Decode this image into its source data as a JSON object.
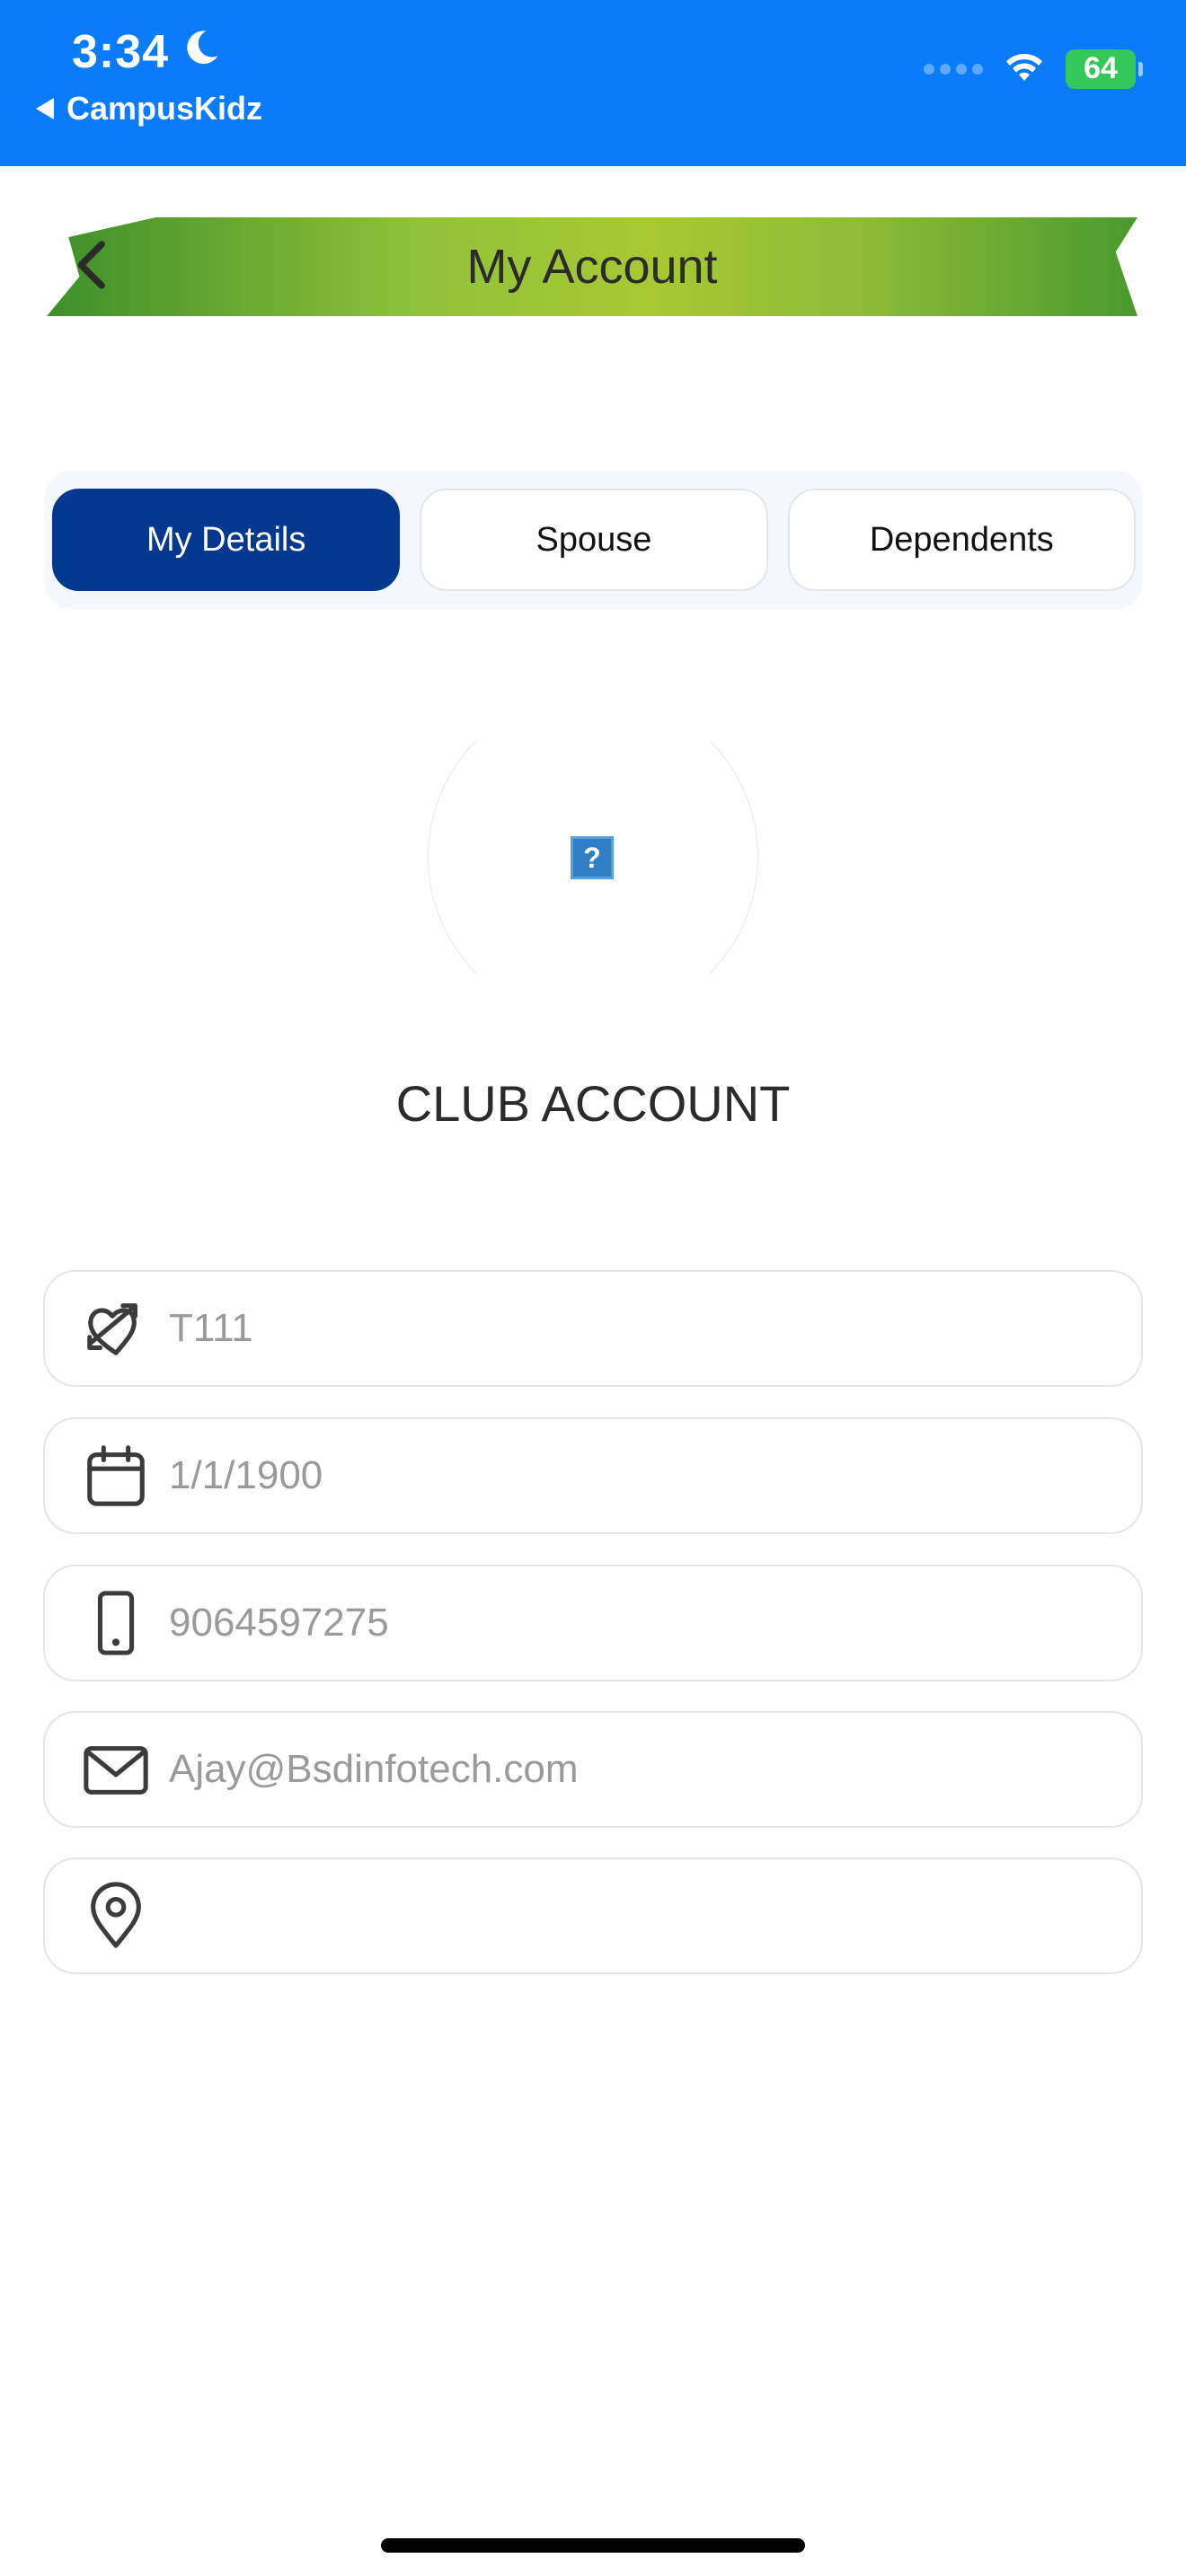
{
  "status_bar": {
    "time": "3:34",
    "back_app": "CampusKidz",
    "battery": "64",
    "icons": [
      "moon-icon",
      "cellular-signal-icon",
      "wifi-icon",
      "battery-charging-icon"
    ],
    "color": "#0a7cfb"
  },
  "header": {
    "title": "My Account",
    "back_icon": "chevron-left-icon"
  },
  "tabs": [
    {
      "label": "My Details",
      "active": true
    },
    {
      "label": "Spouse",
      "active": false
    },
    {
      "label": "Dependents",
      "active": false
    }
  ],
  "avatar": {
    "placeholder": "?"
  },
  "section_title": "CLUB ACCOUNT",
  "fields": [
    {
      "icon": "cupid-heart-icon",
      "value": "T111"
    },
    {
      "icon": "calendar-icon",
      "value": "1/1/1900"
    },
    {
      "icon": "mobile-phone-icon",
      "value": "9064597275"
    },
    {
      "icon": "envelope-icon",
      "value": "Ajay@Bsdinfotech.com"
    },
    {
      "icon": "location-pin-icon",
      "value": ""
    }
  ],
  "colors": {
    "accent": "#03388f",
    "banner_green": "#92c23a"
  }
}
